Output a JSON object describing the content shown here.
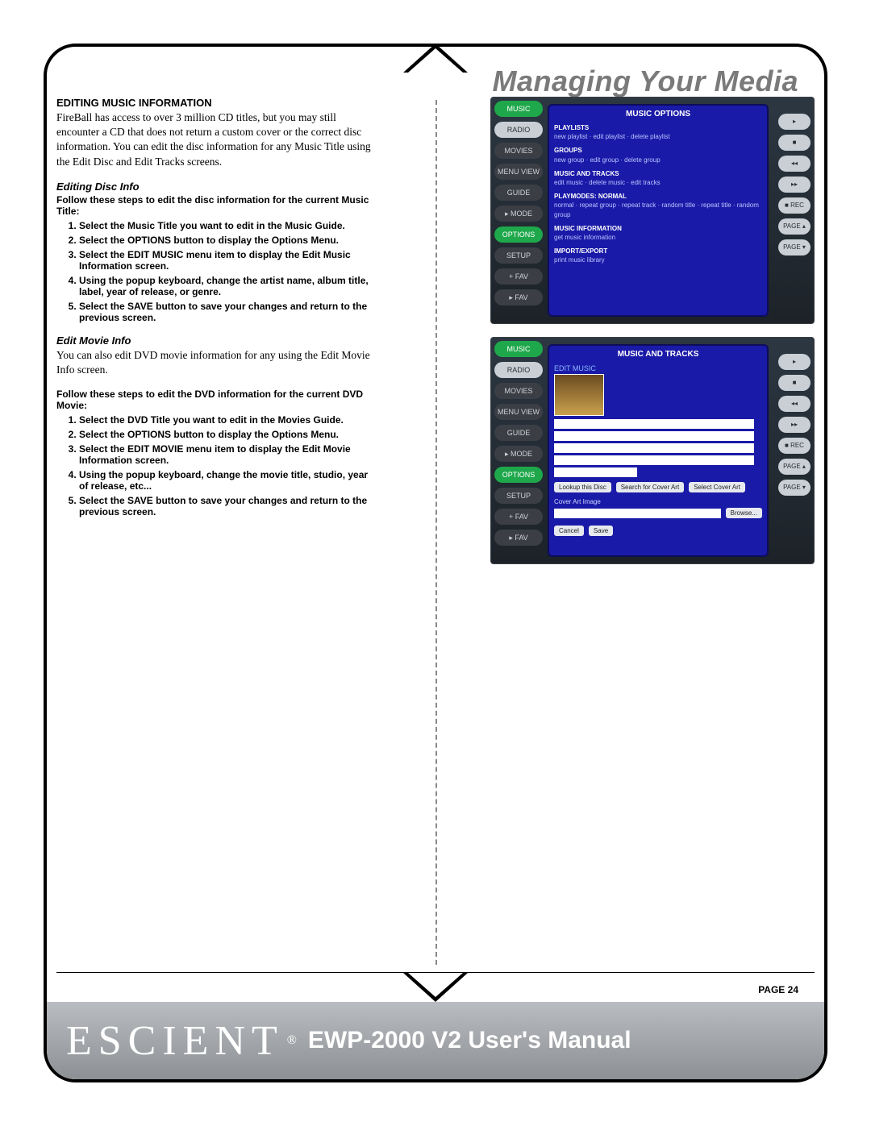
{
  "header": {
    "title": "Managing Your Media"
  },
  "section1": {
    "heading": "EDITING MUSIC INFORMATION",
    "body": "FireBall has access to over 3 million CD titles, but you may still encounter a CD that does not return a custom cover or the correct disc information. You can edit the disc information for any Music Title using the Edit Disc and Edit Tracks screens."
  },
  "discInfo": {
    "heading": "Editing Disc Info",
    "lead": "Follow these steps to edit the disc information for the current Music Title:",
    "steps": [
      "Select the Music Title you want to edit in the Music Guide.",
      "Select the OPTIONS button to display the Options Menu.",
      "Select the EDIT MUSIC menu item to display the Edit Music Information screen.",
      "Using the popup keyboard, change the artist name, album title, label, year of release, or genre.",
      "Select the SAVE button to save your changes and return to the previous screen."
    ]
  },
  "movieInfo": {
    "heading": "Edit Movie Info",
    "body": "You can also edit DVD movie information for any using the Edit Movie Info screen.",
    "lead": "Follow these steps to edit the DVD information for the current DVD Movie:",
    "steps": [
      "Select the DVD Title you want to edit in the Movies Guide.",
      "Select the OPTIONS button to display the Options Menu.",
      "Select the EDIT MOVIE menu item to display the Edit Movie Information screen.",
      "Using the popup keyboard, change the movie title, studio, year of release, etc...",
      "Select the SAVE button to save your changes and return to the previous screen."
    ]
  },
  "shotA": {
    "title": "MUSIC OPTIONS",
    "sidebar": [
      "MUSIC",
      "RADIO",
      "MOVIES",
      "MENU VIEW",
      "GUIDE",
      "▸ MODE",
      "OPTIONS",
      "SETUP",
      "+ FAV",
      "▸ FAV"
    ],
    "groups": [
      {
        "h": "PLAYLISTS",
        "l": "new playlist · edit playlist · delete playlist"
      },
      {
        "h": "GROUPS",
        "l": "new group · edit group · delete group"
      },
      {
        "h": "MUSIC AND TRACKS",
        "l": "edit music · delete music · edit tracks"
      },
      {
        "h": "PLAYMODES: NORMAL",
        "l": "normal · repeat group · repeat track · random title · repeat title · random group"
      },
      {
        "h": "MUSIC INFORMATION",
        "l": "get music information"
      },
      {
        "h": "IMPORT/EXPORT",
        "l": "print music library"
      }
    ],
    "rbtns": [
      "▸",
      "■",
      "◂◂",
      "▸▸",
      "■ REC",
      "PAGE ▴",
      "PAGE ▾"
    ]
  },
  "shotB": {
    "title": "MUSIC AND TRACKS",
    "subtitle": "EDIT MUSIC",
    "sidebar": [
      "MUSIC",
      "RADIO",
      "MOVIES",
      "MENU VIEW",
      "GUIDE",
      "▸ MODE",
      "OPTIONS",
      "SETUP",
      "+ FAV",
      "▸ FAV"
    ],
    "buttons": [
      "Lookup this Disc",
      "Search for Cover Art",
      "Select Cover Art"
    ],
    "coverLabel": "Cover Art Image",
    "browse": "Browse...",
    "footBtns": [
      "Cancel",
      "Save"
    ],
    "rbtns": [
      "▸",
      "■",
      "◂◂",
      "▸▸",
      "■ REC",
      "PAGE ▴",
      "PAGE ▾"
    ]
  },
  "footer": {
    "page": "PAGE 24",
    "brand": "ESCIENT",
    "reg": "®",
    "manual": "EWP-2000 V2 User's Manual"
  }
}
